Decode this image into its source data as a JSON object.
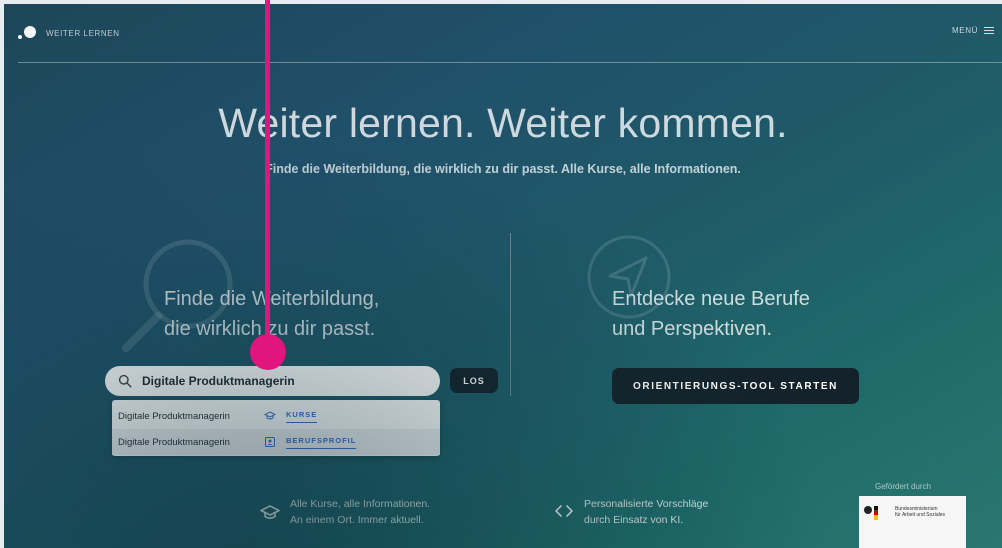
{
  "header": {
    "logo_text": "WEITER LERNEN",
    "menu_label": "MENÜ"
  },
  "hero": {
    "title": "Weiter lernen. Weiter kommen.",
    "subtitle": "Finde die Weiterbildung, die wirklich zu dir passt.  Alle Kurse, alle Informationen."
  },
  "left": {
    "heading_line1": "Finde die Weiterbildung,",
    "heading_line2": "die wirklich zu dir passt."
  },
  "search": {
    "value": "Digitale Produktmanagerin",
    "submit_label": "LOS"
  },
  "suggestions": [
    {
      "label": "Digitale Produktmanagerin",
      "tag": "KURSE",
      "icon": "graduation-cap-icon"
    },
    {
      "label": "Digitale Produktmanagerin",
      "tag": "BERUFSPROFIL",
      "icon": "profile-card-icon"
    }
  ],
  "right": {
    "heading_line1": "Entdecke neue Berufe",
    "heading_line2": "und Perspektiven.",
    "button_label": "ORIENTIERUNGS-TOOL STARTEN"
  },
  "features": [
    {
      "icon": "graduation-cap-icon",
      "line1": "Alle Kurse, alle Informationen.",
      "line2": "An einem Ort. Immer aktuell."
    },
    {
      "icon": "code-brackets-icon",
      "line1": "Personalisierte Vorschläge",
      "line2": "durch Einsatz von KI."
    }
  ],
  "sponsor": {
    "label": "Gefördert durch",
    "logo_text_line1": "Bundesministerium",
    "logo_text_line2": "für Arbeit und Soziales"
  },
  "colors": {
    "accent_pointer": "#e0157d",
    "button_dark": "#14232b",
    "tag_blue": "#3b6fd1"
  }
}
